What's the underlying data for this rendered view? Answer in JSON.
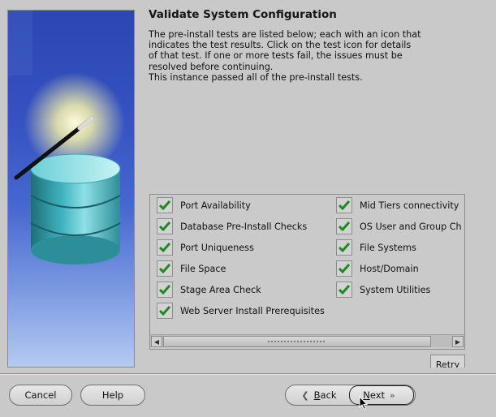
{
  "page": {
    "title": "Validate System Configuration",
    "description": [
      "The pre-install tests are listed below; each with an icon that",
      "indicates the test results.  Click on the test icon for details",
      "of that test.  If one or more tests fail, the issues must be",
      "resolved before continuing.",
      "This instance passed all of the pre-install tests."
    ]
  },
  "tests": {
    "column1": [
      {
        "label": "Port Availability",
        "status": "passed",
        "icon": "check-icon"
      },
      {
        "label": "Database Pre-Install Checks",
        "status": "passed",
        "icon": "check-icon"
      },
      {
        "label": "Port Uniqueness",
        "status": "passed",
        "icon": "check-icon"
      },
      {
        "label": "File Space",
        "status": "passed",
        "icon": "check-icon"
      },
      {
        "label": "Stage Area Check",
        "status": "passed",
        "icon": "check-icon"
      },
      {
        "label": "Web Server Install Prerequisites",
        "status": "passed",
        "icon": "check-icon"
      }
    ],
    "column2": [
      {
        "label": "Mid Tiers connectivity",
        "status": "passed",
        "icon": "check-icon"
      },
      {
        "label": "OS User and Group Ch",
        "status": "passed",
        "icon": "check-icon"
      },
      {
        "label": "File Systems",
        "status": "passed",
        "icon": "check-icon"
      },
      {
        "label": "Host/Domain",
        "status": "passed",
        "icon": "check-icon"
      },
      {
        "label": "System Utilities",
        "status": "passed",
        "icon": "check-icon"
      }
    ]
  },
  "buttons": {
    "retry": "Retry",
    "cancel": "Cancel",
    "help": "Help",
    "back_mnemonic": "B",
    "back_rest": "ack",
    "next_mnemonic": "N",
    "next_rest": "ext"
  },
  "colors": {
    "check_green": "#1f8a1f",
    "background": "#c9c9c9",
    "side_panel_blue": "#3552c0"
  }
}
